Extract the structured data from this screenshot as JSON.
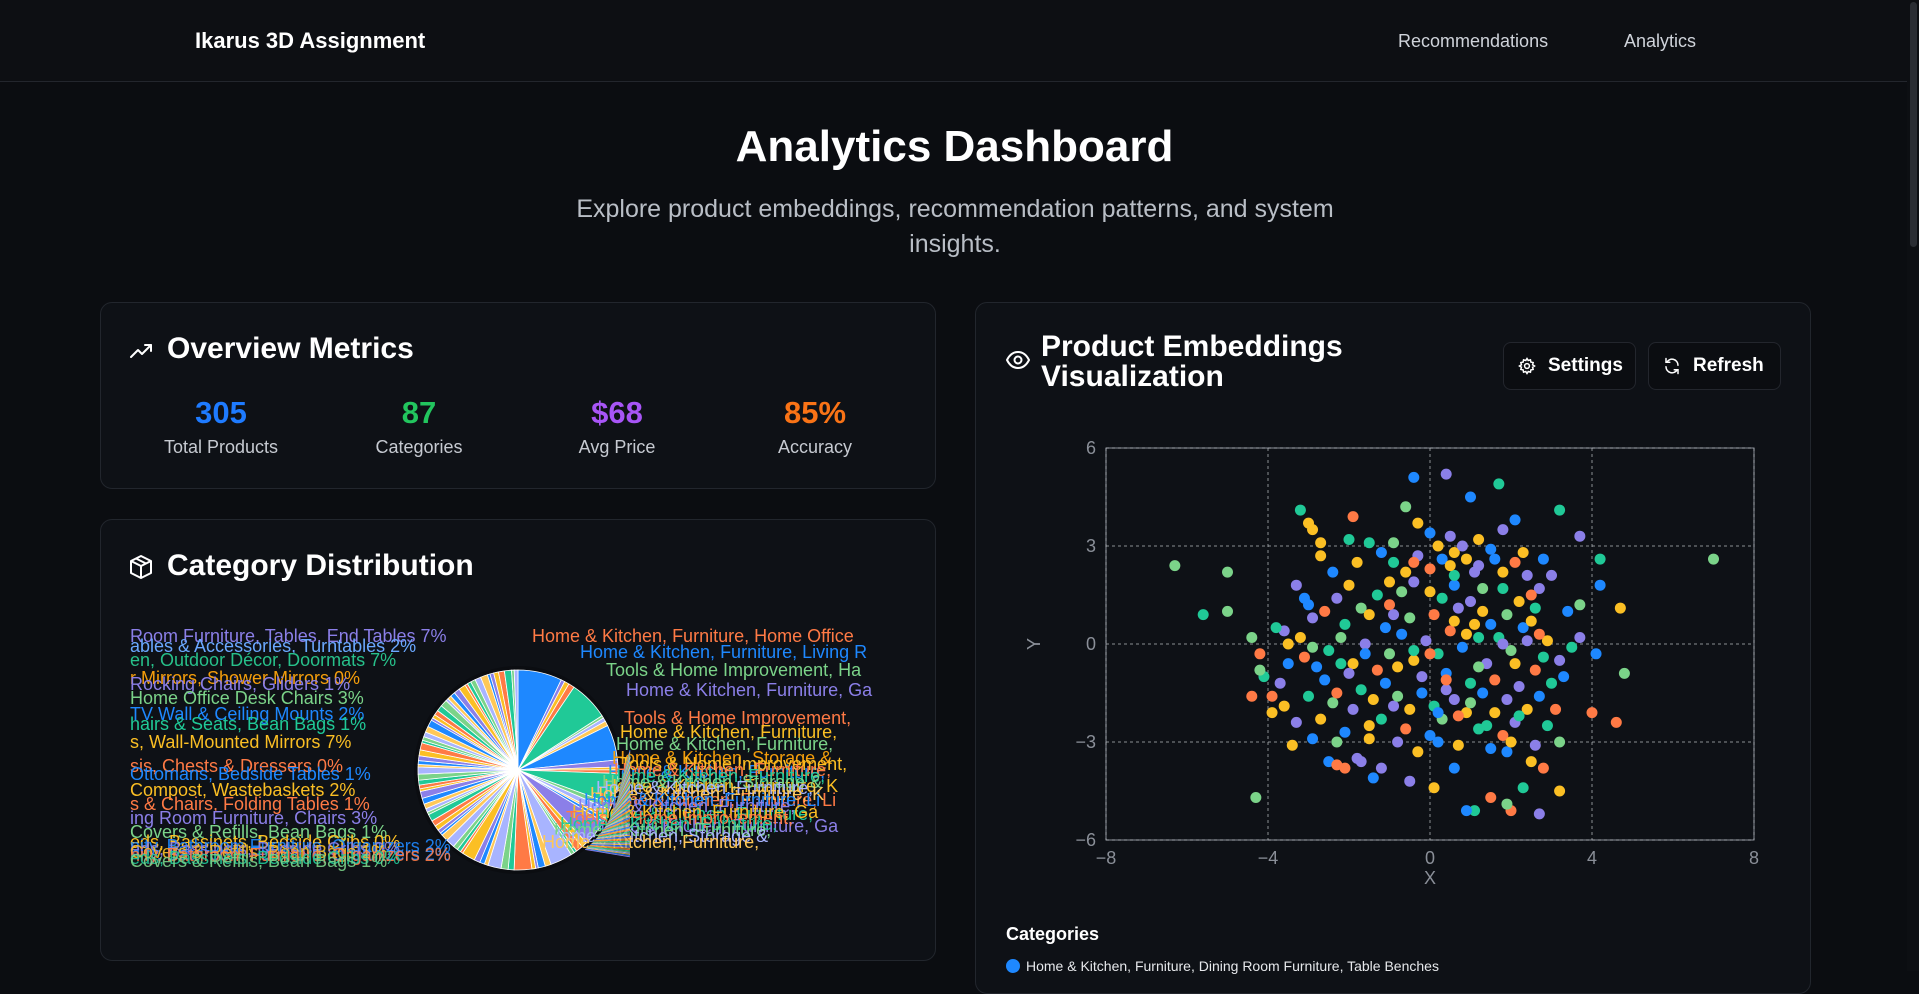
{
  "brand": "Ikarus 3D Assignment",
  "nav": [
    "Recommendations",
    "Analytics"
  ],
  "hero": {
    "title": "Analytics Dashboard",
    "subtitle": "Explore product embeddings, recommendation patterns, and system insights."
  },
  "overview": {
    "title": "Overview Metrics",
    "metrics": [
      {
        "value": "305",
        "label": "Total Products",
        "color": "#1e7bff"
      },
      {
        "value": "87",
        "label": "Categories",
        "color": "#22c55e"
      },
      {
        "value": "$68",
        "label": "Avg Price",
        "color": "#a855f7"
      },
      {
        "value": "85%",
        "label": "Accuracy",
        "color": "#f97316"
      }
    ]
  },
  "category_distribution": {
    "title": "Category Distribution",
    "left_labels": [
      {
        "text": "Room Furniture, Tables, End Tables 7%",
        "color": "#8b7fe8"
      },
      {
        "text": "ables & Accessories, Turntables 2%",
        "color": "#6aa8ff"
      },
      {
        "text": "en, Outdoor Décor, Doormats 7%",
        "color": "#27c08a"
      },
      {
        "text": "r Mirrors, Shower Mirrors 0%",
        "color": "#f59e0b"
      },
      {
        "text": "Rocking Chairs, Gliders 1%",
        "color": "#8b7fe8"
      },
      {
        "text": "Home Office Desk Chairs 3%",
        "color": "#7bd389"
      },
      {
        "text": "TV Wall & Ceiling Mounts 2%",
        "color": "#1e88ff"
      },
      {
        "text": "hairs & Seats, Bean Bags 1%",
        "color": "#20c997"
      },
      {
        "text": "s, Wall-Mounted Mirrors 7%",
        "color": "#fbbf24"
      },
      {
        "text": "sis, Chests & Dressers 0%",
        "color": "#ff7a45"
      },
      {
        "text": "Ottomans, Bedside Tables 1%",
        "color": "#1e88ff"
      },
      {
        "text": "Compost, Wastebaskets 2%",
        "color": "#fbbf24"
      },
      {
        "text": "s & Chairs, Folding Tables 1%",
        "color": "#ff7a45"
      },
      {
        "text": "ing Room Furniture, Chairs 3%",
        "color": "#8b7fe8"
      },
      {
        "text": "Covers & Refills, Bean Bags 1%",
        "color": "#7bd389"
      },
      {
        "text": "eds, Bassinets, Bedside Cribs 0%",
        "color": "#fbbf24"
      },
      {
        "text": "nity, Bathroom Furniture, Organizers 2%",
        "color": "#1e88ff"
      }
    ],
    "right_labels": [
      {
        "text": "Home & Kitchen, Furniture, Home Office",
        "color": "#ff7a45"
      },
      {
        "text": "Home & Kitchen, Furniture, Living R",
        "color": "#1e88ff"
      },
      {
        "text": "Tools & Home Improvement, Ha",
        "color": "#7bd389"
      },
      {
        "text": "Home & Kitchen, Furniture, Ga",
        "color": "#8b7fe8"
      },
      {
        "text": "Tools & Home Improvement, ",
        "color": "#ff7a45"
      },
      {
        "text": "Home & Kitchen, Furniture, ",
        "color": "#fbbf24"
      },
      {
        "text": "Home & Kitchen, Furniture, ",
        "color": "#7bd389"
      },
      {
        "text": "Home & Kitchen, Storage & ",
        "color": "#f59e0b"
      },
      {
        "text": "Home & Kitchen, Furniture, ",
        "color": "#1e88ff"
      },
      {
        "text": "Home & Kitchen, Furniture, K",
        "color": "#fbbf24"
      },
      {
        "text": "Home & Kitchen, Furniture, Li",
        "color": "#ff7a45"
      },
      {
        "text": "Home & Kitchen, Furniture, ",
        "color": "#20c997"
      },
      {
        "text": "Home & Kitchen, Furniture, Ga",
        "color": "#8b7fe8"
      }
    ]
  },
  "embeddings": {
    "title_line1": "Product Embeddings",
    "title_line2": "Visualization",
    "settings_label": "Settings",
    "refresh_label": "Refresh",
    "legend_title": "Categories",
    "legend_first": "Home & Kitchen, Furniture, Dining Room Furniture, Table Benches"
  },
  "chart_data": {
    "type": "scatter",
    "xlabel": "X",
    "ylabel": "Y",
    "xlim": [
      -8,
      8
    ],
    "ylim": [
      -6,
      6
    ],
    "xticks": [
      -8,
      -4,
      0,
      4,
      8
    ],
    "yticks": [
      6,
      3,
      0,
      -3,
      -6
    ],
    "grid": true,
    "colors": [
      "#1e88ff",
      "#8b7fe8",
      "#fbbf24",
      "#ff7a45",
      "#20c997",
      "#7bd389"
    ],
    "points": [
      [
        -6.3,
        2.4,
        5
      ],
      [
        -5,
        2.2,
        5
      ],
      [
        -5.6,
        0.9,
        4
      ],
      [
        -5,
        1,
        5
      ],
      [
        7,
        2.6,
        5
      ],
      [
        4.7,
        1.1,
        2
      ],
      [
        4.8,
        -0.9,
        5
      ],
      [
        4.6,
        -2.4,
        3
      ],
      [
        4,
        -2.1,
        3
      ],
      [
        4.2,
        1.8,
        0
      ],
      [
        4.2,
        2.6,
        4
      ],
      [
        3.7,
        1.2,
        5
      ],
      [
        3.7,
        0.2,
        1
      ],
      [
        4.1,
        -0.3,
        0
      ],
      [
        3.2,
        -3,
        5
      ],
      [
        3.2,
        -4.5,
        2
      ],
      [
        3.2,
        4.1,
        4
      ],
      [
        3.7,
        3.3,
        1
      ],
      [
        -4.3,
        -4.7,
        5
      ],
      [
        -0.4,
        5.1,
        0
      ],
      [
        0.4,
        5.2,
        1
      ],
      [
        1,
        4.5,
        0
      ],
      [
        1.7,
        4.9,
        4
      ],
      [
        2.1,
        3.8,
        0
      ],
      [
        -0.6,
        4.2,
        5
      ],
      [
        -1.9,
        3.9,
        3
      ],
      [
        -3.2,
        4.1,
        4
      ],
      [
        -3,
        3.7,
        2
      ],
      [
        -2.9,
        3.5,
        2
      ],
      [
        -2.7,
        3.1,
        2
      ],
      [
        -0.3,
        3.7,
        2
      ],
      [
        0,
        3.4,
        0
      ],
      [
        0.5,
        3.3,
        1
      ],
      [
        0.6,
        2.8,
        2
      ],
      [
        1.1,
        2.2,
        1
      ],
      [
        1.6,
        2.6,
        0
      ],
      [
        2.3,
        2.8,
        2
      ],
      [
        2.8,
        2.6,
        0
      ],
      [
        3,
        2.1,
        1
      ],
      [
        2.7,
        1.7,
        1
      ],
      [
        2.5,
        1.5,
        3
      ],
      [
        2.2,
        1.3,
        2
      ],
      [
        1.8,
        1.7,
        4
      ],
      [
        1.3,
        1.7,
        5
      ],
      [
        1,
        1.3,
        1
      ],
      [
        0.6,
        1.8,
        0
      ],
      [
        0.3,
        1.4,
        4
      ],
      [
        0,
        1.6,
        2
      ],
      [
        -0.4,
        1.9,
        1
      ],
      [
        -0.7,
        1.6,
        5
      ],
      [
        -1,
        1.2,
        3
      ],
      [
        -1.3,
        1.5,
        4
      ],
      [
        -1.7,
        1.1,
        5
      ],
      [
        -2,
        1.8,
        2
      ],
      [
        -2.3,
        1.4,
        1
      ],
      [
        -2.6,
        1.0,
        3
      ],
      [
        -3,
        1.2,
        0
      ],
      [
        -3.3,
        1.8,
        1
      ],
      [
        -3.6,
        0.4,
        1
      ],
      [
        -3.8,
        0.5,
        4
      ],
      [
        -3.5,
        0,
        2
      ],
      [
        -3.1,
        -0.4,
        3
      ],
      [
        -2.8,
        -0.7,
        0
      ],
      [
        -2.5,
        -0.2,
        4
      ],
      [
        -2.2,
        0.2,
        5
      ],
      [
        -1.9,
        -0.6,
        2
      ],
      [
        -1.6,
        0,
        1
      ],
      [
        -1.3,
        -0.8,
        3
      ],
      [
        -1,
        -0.3,
        5
      ],
      [
        -0.7,
        0.3,
        0
      ],
      [
        -0.4,
        -0.5,
        2
      ],
      [
        -0.1,
        0.1,
        1
      ],
      [
        0.2,
        -0.3,
        4
      ],
      [
        0.5,
        0.4,
        3
      ],
      [
        0.8,
        -0.1,
        0
      ],
      [
        1.1,
        0.6,
        2
      ],
      [
        1.4,
        -0.6,
        1
      ],
      [
        1.7,
        0.2,
        4
      ],
      [
        2,
        -0.2,
        5
      ],
      [
        2.3,
        0.5,
        0
      ],
      [
        2.6,
        -0.8,
        3
      ],
      [
        2.9,
        0.1,
        2
      ],
      [
        3.2,
        -0.5,
        1
      ],
      [
        3,
        -1.2,
        4
      ],
      [
        2.7,
        -1.6,
        0
      ],
      [
        2.4,
        -2,
        2
      ],
      [
        2.1,
        -2.4,
        1
      ],
      [
        1.8,
        -2.8,
        3
      ],
      [
        1.5,
        -3.2,
        0
      ],
      [
        1.2,
        -2.6,
        4
      ],
      [
        0.9,
        -2.1,
        2
      ],
      [
        0.6,
        -1.7,
        1
      ],
      [
        0.3,
        -2.3,
        5
      ],
      [
        0,
        -2.8,
        0
      ],
      [
        -0.3,
        -3.3,
        2
      ],
      [
        -0.6,
        -2.6,
        3
      ],
      [
        -0.9,
        -1.9,
        1
      ],
      [
        -1.2,
        -2.3,
        4
      ],
      [
        -1.5,
        -2.9,
        2
      ],
      [
        -1.8,
        -3.5,
        1
      ],
      [
        -2.1,
        -2.7,
        0
      ],
      [
        -2.4,
        -1.8,
        5
      ],
      [
        -2.7,
        -2.3,
        2
      ],
      [
        -3,
        -1.6,
        4
      ],
      [
        -3.3,
        -2.4,
        1
      ],
      [
        -3.6,
        -1.9,
        2
      ],
      [
        -3.9,
        -1.6,
        3
      ],
      [
        -4.1,
        -1,
        4
      ],
      [
        -4.4,
        -1.6,
        3
      ],
      [
        -4.2,
        -0.8,
        5
      ],
      [
        -3.4,
        -3.1,
        2
      ],
      [
        -2.5,
        -3.6,
        0
      ],
      [
        -2.1,
        -3.8,
        3
      ],
      [
        -1.2,
        -3.8,
        1
      ],
      [
        -0.5,
        -4.2,
        1
      ],
      [
        0.1,
        -4.4,
        2
      ],
      [
        0.6,
        -3.8,
        0
      ],
      [
        1.5,
        -4.7,
        3
      ],
      [
        1.1,
        -5.1,
        4
      ],
      [
        0.9,
        -5.1,
        0
      ],
      [
        2,
        -5.1,
        3
      ],
      [
        2.7,
        -5.2,
        1
      ],
      [
        2.3,
        -4.4,
        4
      ],
      [
        2.5,
        -3.6,
        2
      ],
      [
        1.9,
        -4.9,
        5
      ],
      [
        -2.3,
        -3.7,
        3
      ],
      [
        -1.7,
        -3.6,
        1
      ],
      [
        -1.4,
        -4.1,
        0
      ],
      [
        0.2,
        -3.0,
        0
      ],
      [
        0.7,
        -3.1,
        2
      ],
      [
        1.9,
        -3.3,
        0
      ],
      [
        2.9,
        -2.5,
        4
      ],
      [
        2.6,
        -3.1,
        1
      ],
      [
        -2.1,
        0.6,
        4
      ],
      [
        -1.5,
        0.9,
        2
      ],
      [
        -1.1,
        0.5,
        0
      ],
      [
        -0.8,
        -0.7,
        2
      ],
      [
        -0.5,
        0.8,
        5
      ],
      [
        -0.2,
        -1,
        1
      ],
      [
        0.1,
        0.9,
        3
      ],
      [
        0.4,
        -0.9,
        0
      ],
      [
        0.7,
        1.1,
        1
      ],
      [
        1,
        -1.2,
        4
      ],
      [
        1.3,
        1.0,
        2
      ],
      [
        1.6,
        -1.1,
        3
      ],
      [
        1.9,
        0.9,
        5
      ],
      [
        2.2,
        -1.3,
        1
      ],
      [
        2.5,
        0.7,
        2
      ],
      [
        2.8,
        -0.4,
        4
      ],
      [
        -2.9,
        0.8,
        1
      ],
      [
        -2.6,
        -1.1,
        0
      ],
      [
        -2.3,
        -1.5,
        3
      ],
      [
        -2,
        -0.9,
        1
      ],
      [
        -1.7,
        -1.4,
        4
      ],
      [
        -1.4,
        -1.7,
        2
      ],
      [
        -1.1,
        -1.2,
        0
      ],
      [
        -0.8,
        -1.6,
        5
      ],
      [
        -0.5,
        -2,
        2
      ],
      [
        -0.2,
        -1.5,
        0
      ],
      [
        0.1,
        -1.9,
        4
      ],
      [
        0.4,
        -1.4,
        1
      ],
      [
        0.7,
        -2.2,
        3
      ],
      [
        1,
        -1.8,
        5
      ],
      [
        1.3,
        -1.5,
        0
      ],
      [
        1.6,
        -2.1,
        2
      ],
      [
        1.9,
        -1.7,
        1
      ],
      [
        2.2,
        -2.2,
        4
      ],
      [
        -1.2,
        2.8,
        0
      ],
      [
        -0.9,
        2.5,
        4
      ],
      [
        -0.6,
        2.2,
        2
      ],
      [
        -0.3,
        2.7,
        1
      ],
      [
        0,
        2.3,
        3
      ],
      [
        0.3,
        2.6,
        0
      ],
      [
        0.6,
        2.1,
        4
      ],
      [
        0.9,
        2.6,
        2
      ],
      [
        1.2,
        2.4,
        1
      ],
      [
        1.5,
        2.9,
        0
      ],
      [
        1.8,
        2.2,
        2
      ],
      [
        2.1,
        2.5,
        3
      ],
      [
        2.4,
        2.1,
        1
      ],
      [
        -1.8,
        2.5,
        2
      ],
      [
        -2.4,
        2.2,
        0
      ],
      [
        -2.7,
        2.7,
        2
      ],
      [
        -1.5,
        3.1,
        4
      ],
      [
        -0.9,
        3.1,
        5
      ],
      [
        0.2,
        3.0,
        2
      ],
      [
        0.8,
        3.0,
        1
      ],
      [
        1.2,
        3.2,
        2
      ],
      [
        -3.5,
        -0.6,
        0
      ],
      [
        -3.2,
        0.2,
        2
      ],
      [
        -2.9,
        -0.1,
        5
      ],
      [
        -1.6,
        -0.3,
        0
      ],
      [
        -0.9,
        0.9,
        1
      ],
      [
        0.6,
        0.7,
        2
      ],
      [
        1.2,
        0.2,
        4
      ],
      [
        1.5,
        0.6,
        0
      ],
      [
        2.1,
        -0.6,
        2
      ],
      [
        2.4,
        0.1,
        1
      ],
      [
        2.7,
        0.3,
        3
      ],
      [
        3.3,
        -1.0,
        0
      ],
      [
        3.5,
        -0.1,
        4
      ],
      [
        -4.4,
        0.2,
        5
      ],
      [
        -3.7,
        -1.2,
        1
      ],
      [
        -3.9,
        -2.1,
        2
      ],
      [
        -2,
        3.2,
        4
      ],
      [
        -0.4,
        2.5,
        3
      ],
      [
        0.5,
        2.4,
        2
      ],
      [
        1.8,
        3.5,
        1
      ],
      [
        2.6,
        1.1,
        4
      ],
      [
        3.4,
        1.0,
        0
      ],
      [
        -4.2,
        -0.3,
        3
      ],
      [
        0.4,
        -1.1,
        3
      ],
      [
        0.9,
        0.3,
        2
      ],
      [
        -0.4,
        -0.2,
        4
      ],
      [
        -1.9,
        -2.0,
        1
      ],
      [
        -2.9,
        -2.9,
        0
      ],
      [
        1.4,
        -2.5,
        4
      ],
      [
        2.0,
        -3.0,
        2
      ],
      [
        2.8,
        -3.8,
        3
      ],
      [
        -0.8,
        -3.0,
        1
      ],
      [
        -1.5,
        -2.5,
        2
      ],
      [
        -3.1,
        1.4,
        0
      ],
      [
        -2.2,
        -0.6,
        4
      ],
      [
        0.0,
        -0.3,
        3
      ],
      [
        1.2,
        -0.7,
        5
      ],
      [
        1.8,
        0.0,
        1
      ],
      [
        -1.0,
        1.9,
        2
      ],
      [
        0.2,
        -2.1,
        0
      ],
      [
        -2.3,
        -3.0,
        5
      ],
      [
        3.1,
        -2.0,
        3
      ]
    ]
  }
}
